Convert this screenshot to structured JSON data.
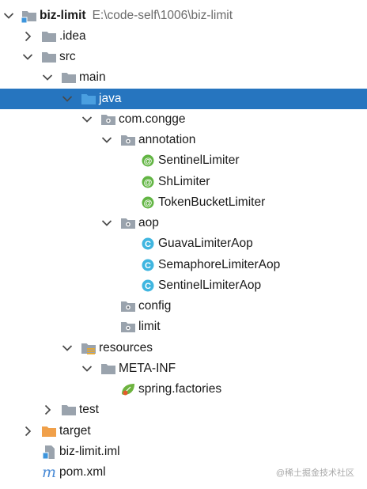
{
  "tree": {
    "root": {
      "name": "biz-limit",
      "path": "E:\\code-self\\1006\\biz-limit"
    },
    "idea": ".idea",
    "src": "src",
    "main": "main",
    "java": "java",
    "package": "com.congge",
    "annotation": "annotation",
    "sentinel_limiter": "SentinelLimiter",
    "sh_limiter": "ShLimiter",
    "token_bucket_limiter": "TokenBucketLimiter",
    "aop": "aop",
    "guava_limiter_aop": "GuavaLimiterAop",
    "semaphore_limiter_aop": "SemaphoreLimiterAop",
    "sentinel_limiter_aop": "SentinelLimiterAop",
    "config": "config",
    "limit": "limit",
    "resources": "resources",
    "meta_inf": "META-INF",
    "spring_factories": "spring.factories",
    "test": "test",
    "target": "target",
    "iml": "biz-limit.iml",
    "pom": "pom.xml"
  },
  "icons": {
    "annotation_badge": "@",
    "class_badge": "C",
    "maven_badge": "m"
  },
  "colors": {
    "selection": "#2675bf",
    "folder_gray": "#9aa3ad",
    "source_folder": "#4a9fe0",
    "target_folder": "#f0a04a",
    "annotation_green": "#62b543",
    "class_blue": "#40b6e0"
  },
  "watermark": "@稀土掘金技术社区"
}
